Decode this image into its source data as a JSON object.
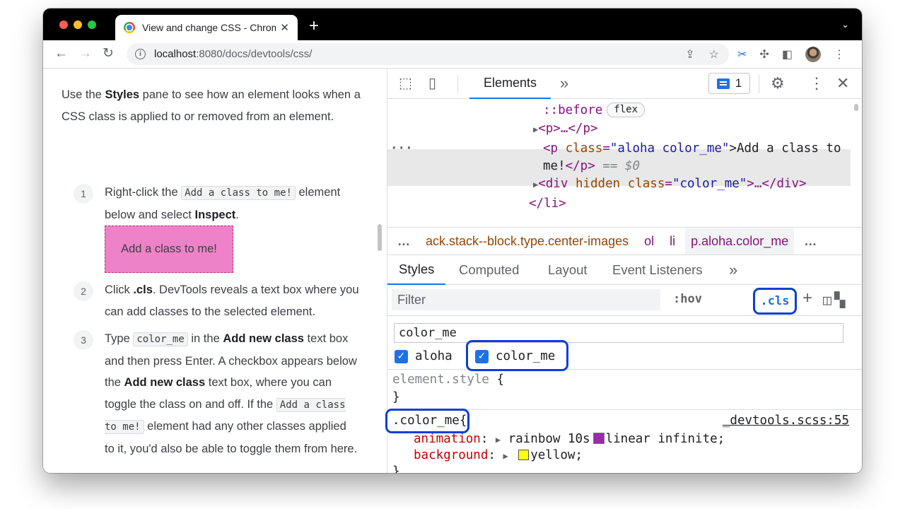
{
  "browser": {
    "tab_title": "View and change CSS - Chrom",
    "tab_close": "✕",
    "new_tab": "+",
    "url_host": "localhost",
    "url_rest": ":8080/docs/devtools/css/"
  },
  "doc": {
    "intro_prefix": "Use the ",
    "intro_bold": "Styles",
    "intro_suffix": " pane to see how an element looks when a CSS class is applied to or removed from an element.",
    "steps": [
      {
        "num": "1",
        "a": "Right-click the ",
        "code": "Add a class to me!",
        "b": " element below and select ",
        "bold": "Inspect",
        "c": "."
      },
      {
        "num": "2",
        "a": "Click ",
        "bold": ".cls",
        "b": ". DevTools reveals a text box where you can add classes to the selected element."
      },
      {
        "num": "3",
        "a": "Type ",
        "code": "color_me",
        "b": " in the ",
        "bold1": "Add new class",
        "c": " text box and then press Enter. A checkbox appears below the ",
        "bold2": "Add new class",
        "d": " text box, where you can toggle the class on and off. If the ",
        "code2": "Add a class to me!",
        "e": " element had any other classes applied to it, you'd also be able to toggle them from here."
      }
    ],
    "demo_box": "Add a class to me!"
  },
  "devtools": {
    "main_tab": "Elements",
    "more_tabs": "»",
    "issues_count": "1",
    "dom": {
      "before": "::before",
      "flex_badge": "flex",
      "p_collapsed": "<p>…</p>",
      "selected_open_tag": "<p",
      "selected_attr": "class",
      "selected_val": "\"aloha color_me\"",
      "selected_text": ">Add a class to",
      "selected_line2": "me!</p>",
      "selected_eq": "== $0",
      "div_tag": "<div",
      "div_hidden": "hidden",
      "div_attr": "class",
      "div_val": "\"color_me\"",
      "div_rest": ">…</div>",
      "li_close": "</li>",
      "ellipsis": "···"
    },
    "breadcrumbs": [
      "…",
      "ack.stack--block.type.center-images",
      "ol",
      "li",
      "p.aloha.color_me",
      "…"
    ],
    "subtabs": [
      "Styles",
      "Computed",
      "Layout",
      "Event Listeners",
      "»"
    ],
    "filter_placeholder": "Filter",
    "hov": ":hov",
    "cls": ".cls",
    "new_class_value": "color_me",
    "classes": [
      {
        "name": "aloha",
        "checked": true
      },
      {
        "name": "color_me",
        "checked": true
      }
    ],
    "rules": {
      "element_style": "element.style",
      "open_brace": "{",
      "close_brace": "}",
      "selector": ".color_me",
      "source": "_devtools.scss:55",
      "animation_prop": "animation",
      "animation_val_a": "rainbow 10s",
      "animation_val_b": "linear infinite;",
      "background_prop": "background",
      "background_val": "yellow;"
    }
  },
  "colors": {
    "highlight": "#0b3fd6",
    "demo_box": "#ee82c8",
    "accent": "#1a73e8"
  }
}
